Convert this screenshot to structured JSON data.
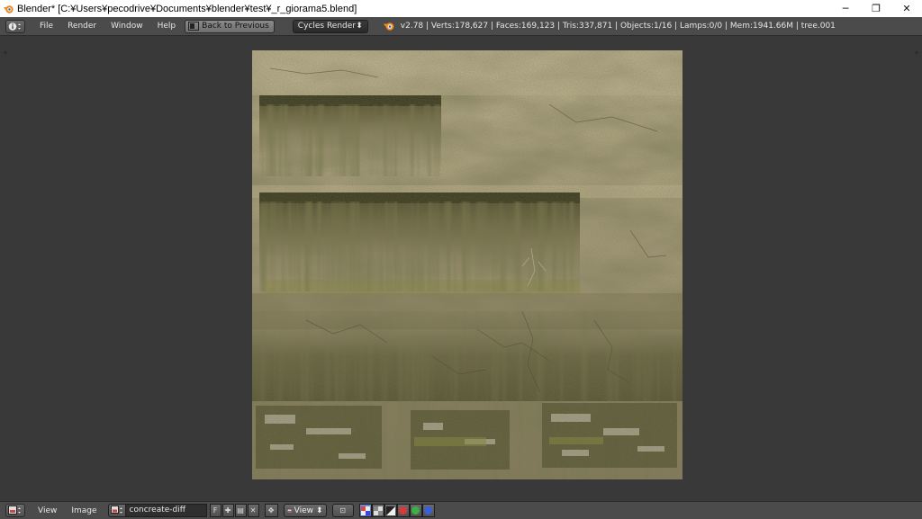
{
  "window": {
    "title": "Blender* [C:¥Users¥pecodrive¥Documents¥blender¥test¥_r_giorama5.blend]",
    "controls": {
      "minimize": "─",
      "maximize": "❐",
      "close": "✕"
    }
  },
  "info_header": {
    "menu": [
      "File",
      "Render",
      "Window",
      "Help"
    ],
    "back_button": "Back to Previous",
    "render_engine": "Cycles Render",
    "stats": "v2.78 | Verts:178,627 | Faces:169,123 | Tris:337,871 | Objects:1/16 | Lamps:0/0 | Mem:1941.66M | tree.001"
  },
  "image_editor": {
    "image_description": "concrete wall texture",
    "corner_glyph": "+"
  },
  "footer": {
    "menu": [
      "View",
      "Image"
    ],
    "image_name": "concreate-diff",
    "fake_user_label": "F",
    "view_label": "View"
  },
  "colors": {
    "header_bg": "#4b4b4b",
    "editor_bg": "#393939",
    "accent_blue": "#5680c2",
    "title_bg": "#ffffff"
  }
}
